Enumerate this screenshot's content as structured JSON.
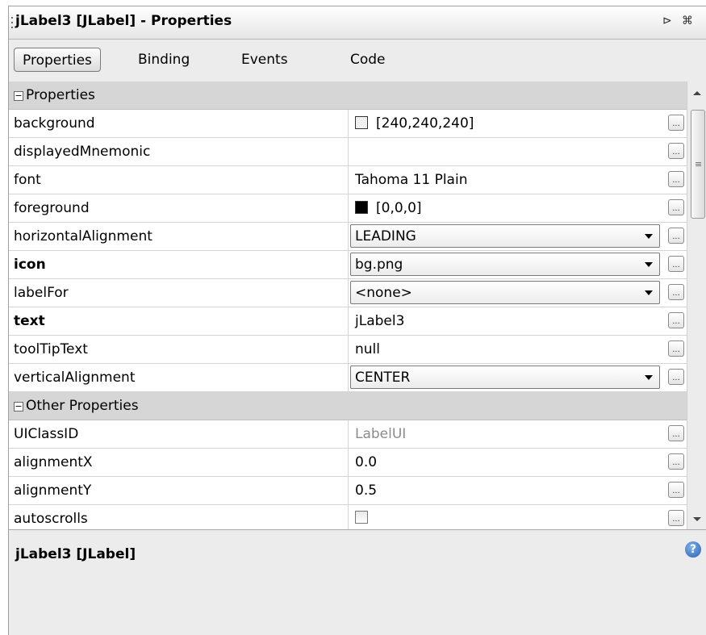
{
  "window": {
    "title": "jLabel3 [JLabel] - Properties",
    "pin_icon": "pin-icon",
    "maximize_icon": "maximize-icon"
  },
  "tabs": [
    {
      "label": "Properties",
      "active": true
    },
    {
      "label": "Binding",
      "active": false
    },
    {
      "label": "Events",
      "active": false
    },
    {
      "label": "Code",
      "active": false
    }
  ],
  "sections": {
    "properties": "Properties",
    "other_properties": "Other Properties"
  },
  "rows": {
    "background": {
      "name": "background",
      "value": "[240,240,240]",
      "swatch": "#f0f0f0"
    },
    "displayedMnemonic": {
      "name": "displayedMnemonic",
      "value": ""
    },
    "font": {
      "name": "font",
      "value": "Tahoma 11 Plain"
    },
    "foreground": {
      "name": "foreground",
      "value": "[0,0,0]",
      "swatch": "#000000"
    },
    "horizontalAlignment": {
      "name": "horizontalAlignment",
      "value": "LEADING"
    },
    "icon": {
      "name": "icon",
      "value": "bg.png"
    },
    "labelFor": {
      "name": "labelFor",
      "value": "<none>"
    },
    "text": {
      "name": "text",
      "value": "jLabel3"
    },
    "toolTipText": {
      "name": "toolTipText",
      "value": "null"
    },
    "verticalAlignment": {
      "name": "verticalAlignment",
      "value": "CENTER"
    },
    "UIClassID": {
      "name": "UIClassID",
      "value": "LabelUI"
    },
    "alignmentX": {
      "name": "alignmentX",
      "value": "0.0"
    },
    "alignmentY": {
      "name": "alignmentY",
      "value": "0.5"
    },
    "autoscrolls": {
      "name": "autoscrolls",
      "checked": false
    }
  },
  "ellipsis": "...",
  "footer": {
    "title": "jLabel3 [JLabel]",
    "help_glyph": "?"
  }
}
